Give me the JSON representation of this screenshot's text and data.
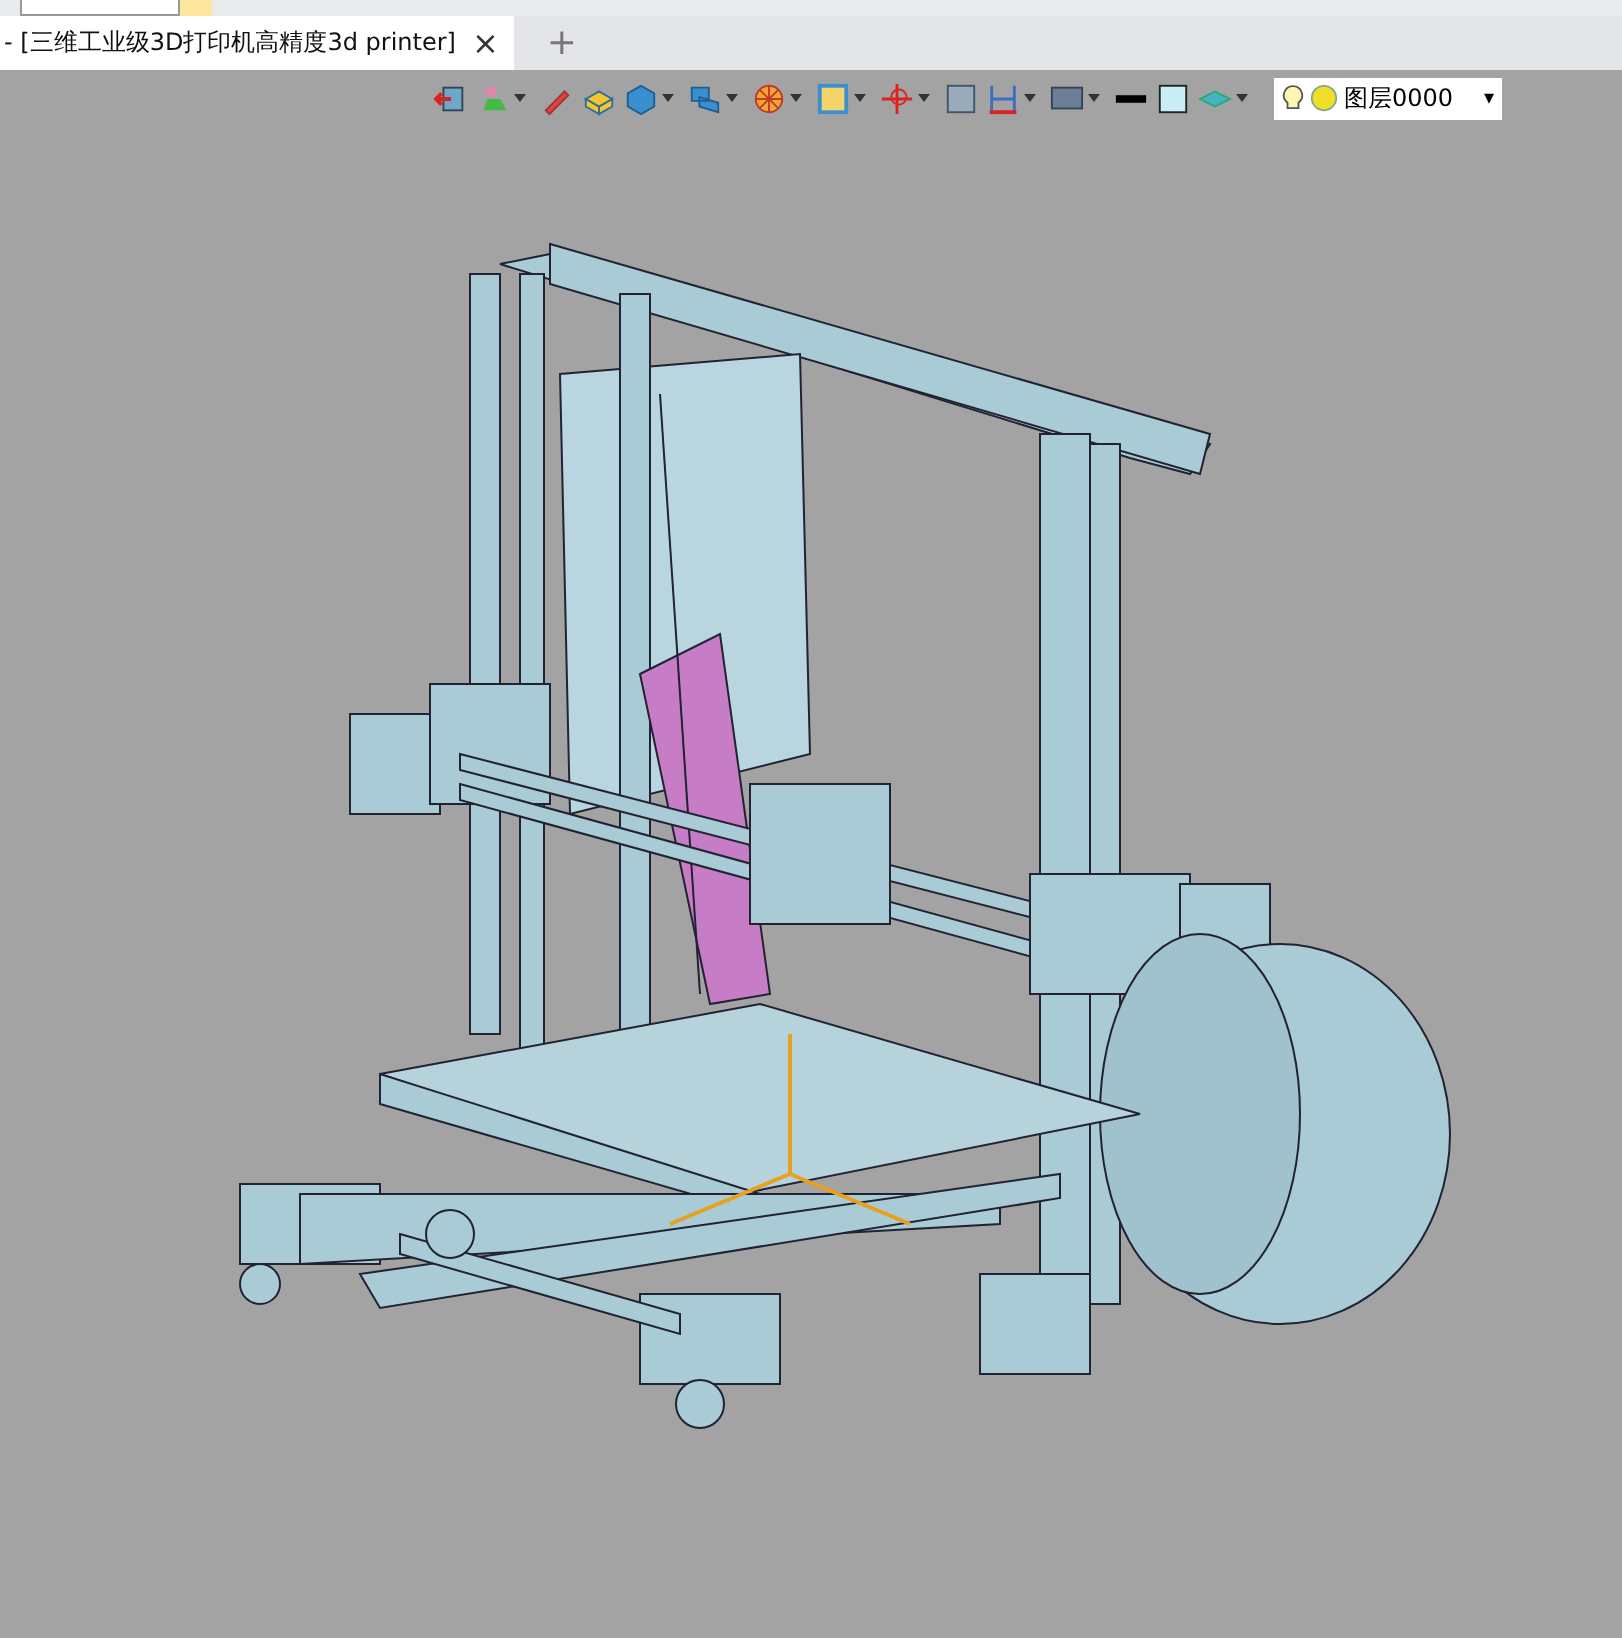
{
  "document_tabs": [
    {
      "title": "- [三维工业级3D打印机高精度3d printer]",
      "close": "×",
      "selected": true
    }
  ],
  "new_tab": "+",
  "layer_selector": {
    "value": "图层0000",
    "arrow": "▾"
  }
}
